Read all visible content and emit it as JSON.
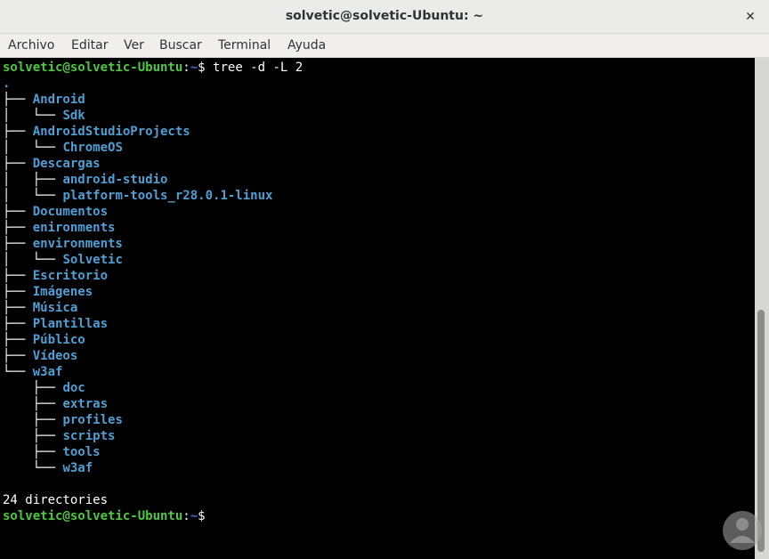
{
  "window": {
    "title": "solvetic@solvetic-Ubuntu: ~",
    "close_glyph": "✕"
  },
  "menu": [
    {
      "label": "Archivo"
    },
    {
      "label": "Editar"
    },
    {
      "label": "Ver"
    },
    {
      "label": "Buscar"
    },
    {
      "label": "Terminal"
    },
    {
      "label": "Ayuda"
    }
  ],
  "terminal": {
    "prompt_user": "solvetic@solvetic-Ubuntu",
    "prompt_sep": ":",
    "prompt_path": "~",
    "prompt_symbol": "$ ",
    "command": "tree -d -L 2",
    "root_dot": ".",
    "tree": [
      {
        "branch": "├── ",
        "name": "Android"
      },
      {
        "branch": "│   └── ",
        "name": "Sdk"
      },
      {
        "branch": "├── ",
        "name": "AndroidStudioProjects"
      },
      {
        "branch": "│   └── ",
        "name": "ChromeOS"
      },
      {
        "branch": "├── ",
        "name": "Descargas"
      },
      {
        "branch": "│   ├── ",
        "name": "android-studio"
      },
      {
        "branch": "│   └── ",
        "name": "platform-tools_r28.0.1-linux"
      },
      {
        "branch": "├── ",
        "name": "Documentos"
      },
      {
        "branch": "├── ",
        "name": "enironments"
      },
      {
        "branch": "├── ",
        "name": "environments"
      },
      {
        "branch": "│   └── ",
        "name": "Solvetic"
      },
      {
        "branch": "├── ",
        "name": "Escritorio"
      },
      {
        "branch": "├── ",
        "name": "Imágenes"
      },
      {
        "branch": "├── ",
        "name": "Música"
      },
      {
        "branch": "├── ",
        "name": "Plantillas"
      },
      {
        "branch": "├── ",
        "name": "Público"
      },
      {
        "branch": "├── ",
        "name": "Vídeos"
      },
      {
        "branch": "└── ",
        "name": "w3af"
      },
      {
        "branch": "    ├── ",
        "name": "doc"
      },
      {
        "branch": "    ├── ",
        "name": "extras"
      },
      {
        "branch": "    ├── ",
        "name": "profiles"
      },
      {
        "branch": "    ├── ",
        "name": "scripts"
      },
      {
        "branch": "    ├── ",
        "name": "tools"
      },
      {
        "branch": "    └── ",
        "name": "w3af"
      }
    ],
    "summary": "24 directories"
  },
  "colors": {
    "prompt_user": "#4ec93f",
    "prompt_path": "#3b6fd6",
    "directory": "#4f9fd4",
    "background": "#000000"
  },
  "watermark_icon": "solvetic-logo-icon"
}
